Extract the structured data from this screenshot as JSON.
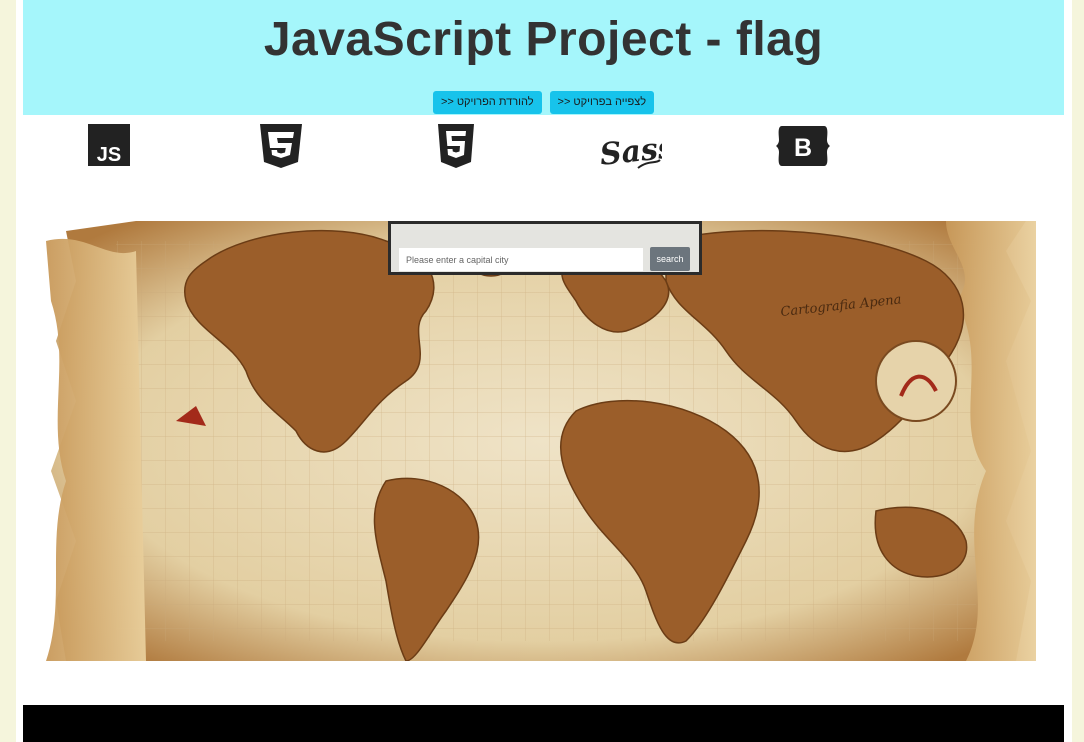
{
  "header": {
    "title": "JavaScript Project - flag",
    "buttons": [
      {
        "label": "לצפייה בפרויקט <<"
      },
      {
        "label": "להורדת הפרויקט <<"
      }
    ]
  },
  "tech_icons": [
    {
      "name": "js-icon",
      "text": "JS"
    },
    {
      "name": "css3-icon",
      "text": ""
    },
    {
      "name": "html5-icon",
      "text": ""
    },
    {
      "name": "sass-icon",
      "text": "Sass"
    },
    {
      "name": "bootstrap-icon",
      "text": "B"
    }
  ],
  "search": {
    "placeholder": "Please enter a capital city",
    "value": "",
    "button_label": "search"
  },
  "map_caption": "Cartografia Apena",
  "colors": {
    "background": "#f5f5dc",
    "hero": "#a5f6fb",
    "button": "#17c3eb",
    "search_button": "#6c757d",
    "footer": "#000000"
  }
}
